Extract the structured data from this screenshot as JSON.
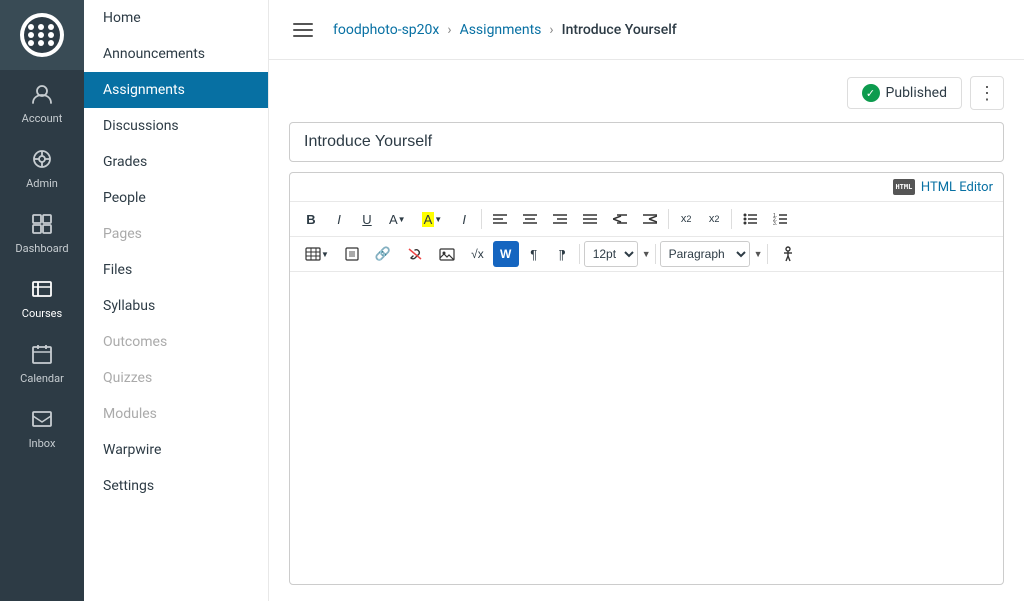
{
  "sidebar": {
    "items": [
      {
        "id": "account",
        "label": "Account",
        "icon": "account-icon"
      },
      {
        "id": "admin",
        "label": "Admin",
        "icon": "admin-icon"
      },
      {
        "id": "dashboard",
        "label": "Dashboard",
        "icon": "dashboard-icon"
      },
      {
        "id": "courses",
        "label": "Courses",
        "icon": "courses-icon",
        "active": true
      },
      {
        "id": "calendar",
        "label": "Calendar",
        "icon": "calendar-icon"
      },
      {
        "id": "inbox",
        "label": "Inbox",
        "icon": "inbox-icon"
      }
    ]
  },
  "course_nav": {
    "items": [
      {
        "id": "home",
        "label": "Home",
        "active": false,
        "disabled": false
      },
      {
        "id": "announcements",
        "label": "Announcements",
        "active": false,
        "disabled": false
      },
      {
        "id": "assignments",
        "label": "Assignments",
        "active": true,
        "disabled": false
      },
      {
        "id": "discussions",
        "label": "Discussions",
        "active": false,
        "disabled": false
      },
      {
        "id": "grades",
        "label": "Grades",
        "active": false,
        "disabled": false
      },
      {
        "id": "people",
        "label": "People",
        "active": false,
        "disabled": false
      },
      {
        "id": "pages",
        "label": "Pages",
        "active": false,
        "disabled": true
      },
      {
        "id": "files",
        "label": "Files",
        "active": false,
        "disabled": false
      },
      {
        "id": "syllabus",
        "label": "Syllabus",
        "active": false,
        "disabled": false
      },
      {
        "id": "outcomes",
        "label": "Outcomes",
        "active": false,
        "disabled": true
      },
      {
        "id": "quizzes",
        "label": "Quizzes",
        "active": false,
        "disabled": true
      },
      {
        "id": "modules",
        "label": "Modules",
        "active": false,
        "disabled": true
      },
      {
        "id": "warpwire",
        "label": "Warpwire",
        "active": false,
        "disabled": false
      },
      {
        "id": "settings",
        "label": "Settings",
        "active": false,
        "disabled": false
      }
    ]
  },
  "breadcrumb": {
    "course": "foodphoto-sp20x",
    "section": "Assignments",
    "page": "Introduce Yourself"
  },
  "published": {
    "label": "Published",
    "status": true
  },
  "editor": {
    "title_placeholder": "Introduce Yourself",
    "title_value": "Introduce Yourself",
    "html_editor_label": "HTML Editor",
    "toolbar": {
      "bold": "B",
      "italic": "I",
      "underline": "U",
      "font_color": "A",
      "background_color": "A",
      "italic2": "I",
      "align_left": "≡",
      "align_center": "≡",
      "align_right": "≡",
      "align_justify": "≡",
      "indent": "⇥",
      "outdent": "⇤",
      "superscript": "x²",
      "subscript": "x₂",
      "unordered_list": "≡",
      "ordered_list": "≡",
      "table": "⊞",
      "table2": "▦",
      "link": "🔗",
      "unlink": "⛓",
      "image": "🖼",
      "formula": "√x",
      "word": "W",
      "paragraph_marks": "¶",
      "rtl_marks": "¶",
      "font_size": "12pt",
      "paragraph": "Paragraph",
      "accessibility": "♿"
    }
  }
}
